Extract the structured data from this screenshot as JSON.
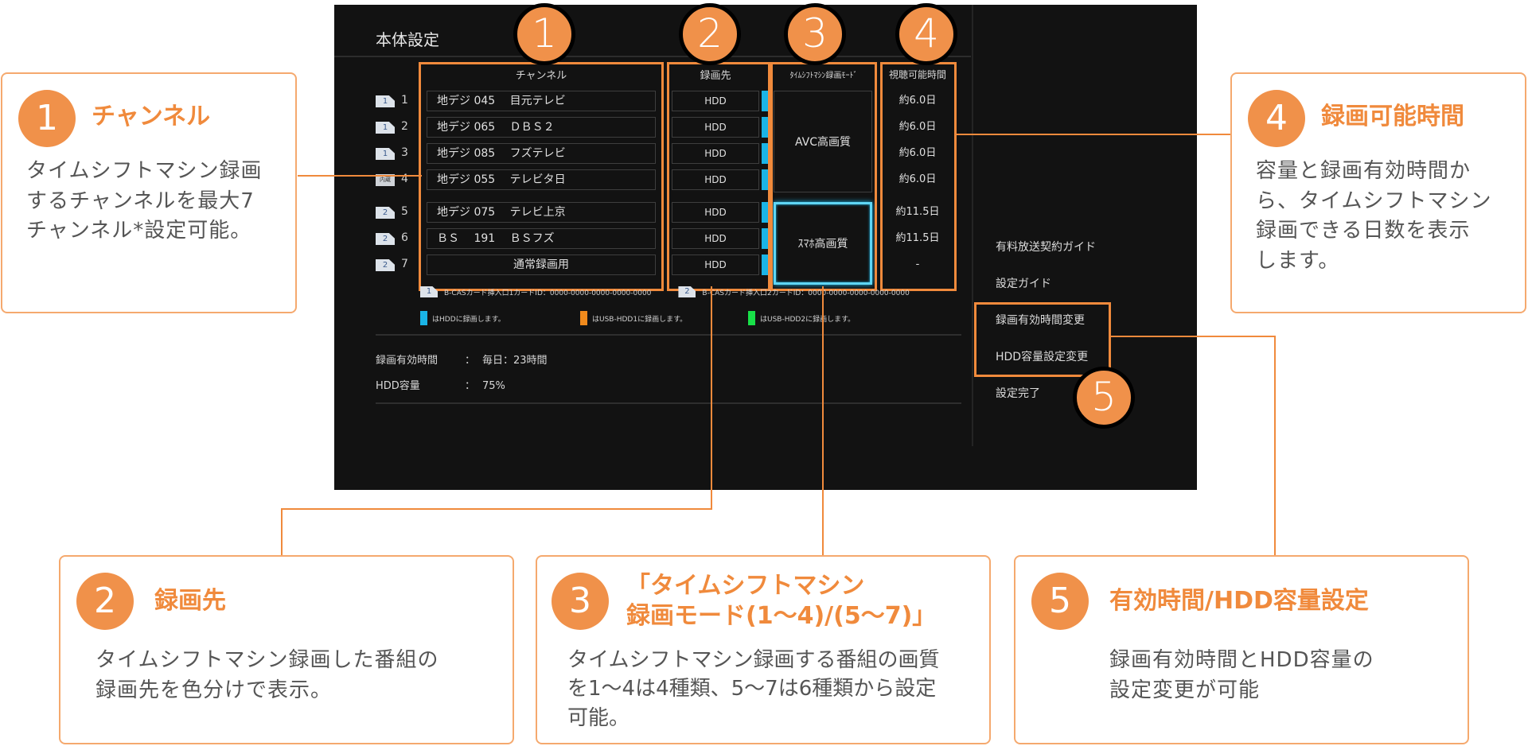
{
  "screen": {
    "title": "本体設定",
    "columns": {
      "channel": "チャンネル",
      "destination": "録画先",
      "mode": "ﾀｲﾑｼﾌﾄﾏｼﾝ録画ﾓｰﾄﾞ",
      "available": "視聴可能時間"
    },
    "rows": [
      {
        "card": "1",
        "num": "1",
        "channel": "地デジ 045　 目元テレビ",
        "dest": "HDD",
        "available": "約6.0日"
      },
      {
        "card": "1",
        "num": "2",
        "channel": "地デジ 065　 ＤＢＳ２",
        "dest": "HDD",
        "available": "約6.0日"
      },
      {
        "card": "1",
        "num": "3",
        "channel": "地デジ 085　 フズテレビ",
        "dest": "HDD",
        "available": "約6.0日"
      },
      {
        "card": "内蔵",
        "num": "4",
        "channel": "地デジ 055　 テレビタ日",
        "dest": "HDD",
        "available": "約6.0日"
      },
      {
        "card": "2",
        "num": "5",
        "channel": "地デジ 075　 テレビ上京",
        "dest": "HDD",
        "available": "約11.5日"
      },
      {
        "card": "2",
        "num": "6",
        "channel": "ＢＳ　 191　 ＢＳフズ",
        "dest": "HDD",
        "available": "約11.5日"
      },
      {
        "card": "2",
        "num": "7",
        "channel": "通常録画用",
        "dest": "HDD",
        "available": "-"
      }
    ],
    "modes": [
      {
        "label": "AVC高画質",
        "rows": "1-4"
      },
      {
        "label": "ｽﾏﾎ高画質",
        "rows": "5-7",
        "selected": true
      }
    ],
    "card_ids": [
      {
        "card": "1",
        "text": "B-CASカード挿入口1カードID：0000-0000-0000-0000-0000"
      },
      {
        "card": "2",
        "text": "B-CASカード挿入口2カードID：0000-0000-0000-0000-0000"
      }
    ],
    "dest_legend": [
      {
        "color": "#1ab4e6",
        "text": "はHDDに録画します。"
      },
      {
        "color": "#f08a1c",
        "text": "はUSB-HDD1に録画します。"
      },
      {
        "color": "#18e048",
        "text": "はUSB-HDD2に録画します。"
      }
    ],
    "info": [
      {
        "key": "録画有効時間",
        "sep": "：",
        "value": "毎日：23時間"
      },
      {
        "key": "HDD容量",
        "sep": "：",
        "value": "75%"
      }
    ],
    "menu": [
      "有料放送契約ガイド",
      "設定ガイド",
      "録画有効時間変更",
      "HDD容量設定変更",
      "設定完了"
    ]
  },
  "badges": [
    "1",
    "2",
    "3",
    "4",
    "5"
  ],
  "callouts": [
    {
      "num": "1",
      "title": "チャンネル",
      "body": "タイムシフトマシン録画\nするチャンネルを最大7\nチャンネル*設定可能。"
    },
    {
      "num": "2",
      "title": "録画先",
      "body": "タイムシフトマシン録画した番組の\n録画先を色分けで表示。"
    },
    {
      "num": "3",
      "title": "「タイムシフトマシン\n録画モード(1〜4)/(5〜7)」",
      "body": "タイムシフトマシン録画する番組の画質\nを1〜4は4種類、5〜7は6種類から設定\n可能。"
    },
    {
      "num": "4",
      "title": "録画可能時間",
      "body": "容量と録画有効時間か\nら、タイムシフトマシン\n録画できる日数を表示\nします。"
    },
    {
      "num": "5",
      "title": "有効時間/HDD容量設定",
      "body": "録画有効時間とHDD容量の\n設定変更が可能"
    }
  ],
  "colors": {
    "accent": "#f08a3c",
    "hdd": "#1ab4e6",
    "screen_bg": "#121212"
  }
}
